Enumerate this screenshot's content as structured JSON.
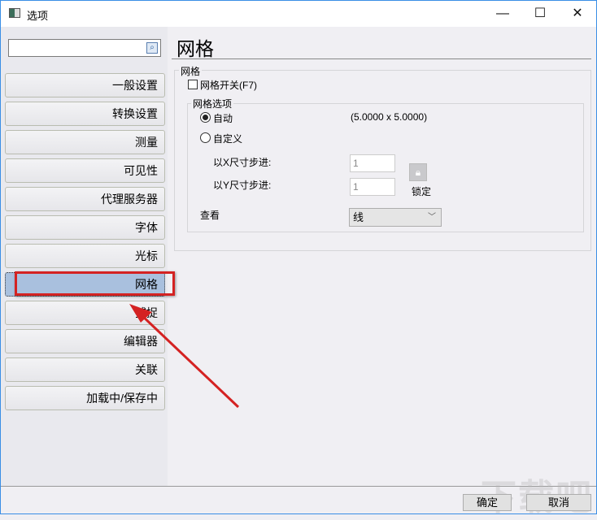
{
  "window": {
    "title": "选项",
    "minimize": "—",
    "maximize": "☐",
    "close": "✕"
  },
  "sidebar": {
    "search_placeholder": "",
    "items": [
      {
        "label": "一般设置"
      },
      {
        "label": "转换设置"
      },
      {
        "label": "测量"
      },
      {
        "label": "可见性"
      },
      {
        "label": "代理服务器"
      },
      {
        "label": "字体"
      },
      {
        "label": "光标"
      },
      {
        "label": "网格",
        "selected": true
      },
      {
        "label": "捕捉"
      },
      {
        "label": "编辑器"
      },
      {
        "label": "关联"
      },
      {
        "label": "加载中/保存中"
      }
    ]
  },
  "main": {
    "heading": "网格",
    "group_title": "网格",
    "grid_toggle": {
      "label": "网格开关(F7)",
      "checked": false
    },
    "options_title": "网格选项",
    "auto": {
      "label": "自动",
      "selected": true,
      "value": "(5.0000 x 5.0000)"
    },
    "custom": {
      "label": "自定义",
      "selected": false
    },
    "x_step": {
      "label": "以X尺寸步进:",
      "value": "1"
    },
    "y_step": {
      "label": "以Y尺寸步进:",
      "value": "1"
    },
    "lock_label": "锁定",
    "view": {
      "label": "查看",
      "value": "线"
    }
  },
  "footer": {
    "ok": "确定",
    "cancel": "取消"
  },
  "watermark": "下载吧",
  "colors": {
    "highlight": "#d42222",
    "selected": "#a9c0de"
  }
}
